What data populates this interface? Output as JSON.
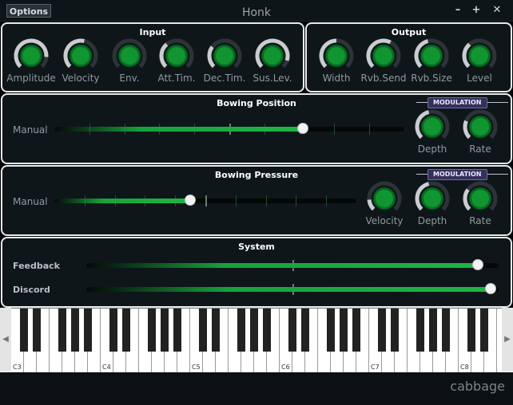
{
  "window": {
    "options_label": "Options",
    "title": "Honk",
    "minimize": "–",
    "maximize": "+",
    "close": "✕"
  },
  "input": {
    "title": "Input",
    "knobs": [
      {
        "label": "Amplitude",
        "value": 0.85
      },
      {
        "label": "Velocity",
        "value": 0.55
      },
      {
        "label": "Env.",
        "value": 0.0
      },
      {
        "label": "Att.Tim.",
        "value": 0.35
      },
      {
        "label": "Dec.Tim.",
        "value": 0.3
      },
      {
        "label": "Sus.Lev.",
        "value": 0.9
      }
    ]
  },
  "output": {
    "title": "Output",
    "knobs": [
      {
        "label": "Width",
        "value": 0.5
      },
      {
        "label": "Rvb.Send",
        "value": 0.6
      },
      {
        "label": "Rvb.Size",
        "value": 0.45
      },
      {
        "label": "Level",
        "value": 0.35
      }
    ]
  },
  "bowing_position": {
    "title": "Bowing Position",
    "slider_label": "Manual",
    "value": 0.71,
    "modulation": "MODULATION",
    "knobs": [
      {
        "label": "Depth",
        "value": 0.45
      },
      {
        "label": "Rate",
        "value": 0.25
      }
    ]
  },
  "bowing_pressure": {
    "title": "Bowing Pressure",
    "slider_label": "Manual",
    "value": 0.45,
    "modulation": "MODULATION",
    "knobs": [
      {
        "label": "Velocity",
        "value": 0.15
      },
      {
        "label": "Depth",
        "value": 0.45
      },
      {
        "label": "Rate",
        "value": 0.3
      }
    ]
  },
  "system": {
    "title": "System",
    "sliders": [
      {
        "label": "Feedback",
        "value": 0.95
      },
      {
        "label": "Discord",
        "value": 0.98
      }
    ]
  },
  "keyboard": {
    "octave_labels": [
      "C3",
      "C4",
      "C5",
      "C6",
      "C7",
      "C8"
    ],
    "scroll_left": "◀",
    "scroll_right": "▶"
  },
  "brand": {
    "logo_text": "cabbage"
  },
  "colors": {
    "accent": "#17a13a",
    "knob_ring": "#c9cdd0",
    "panel_border": "#e8ecee"
  }
}
